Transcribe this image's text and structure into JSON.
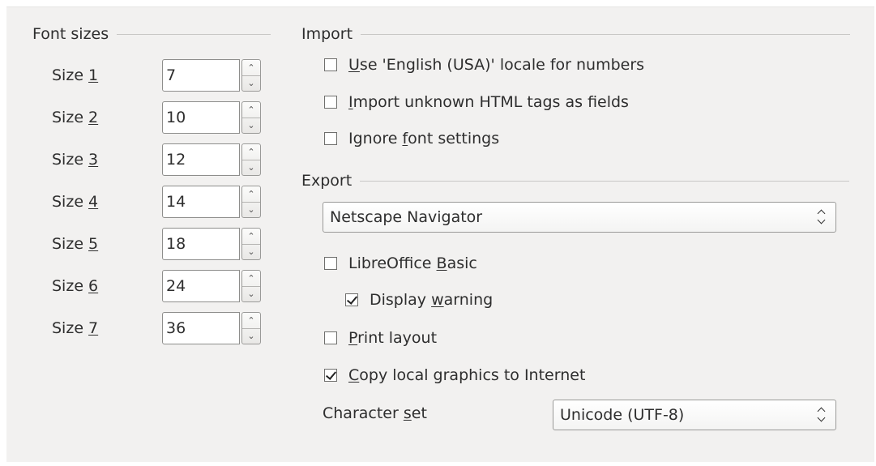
{
  "font_sizes": {
    "title": "Font sizes",
    "rows": [
      {
        "label": "Size ",
        "key": "1",
        "value": "7"
      },
      {
        "label": "Size ",
        "key": "2",
        "value": "10"
      },
      {
        "label": "Size ",
        "key": "3",
        "value": "12"
      },
      {
        "label": "Size ",
        "key": "4",
        "value": "14"
      },
      {
        "label": "Size ",
        "key": "5",
        "value": "18"
      },
      {
        "label": "Size ",
        "key": "6",
        "value": "24"
      },
      {
        "label": "Size ",
        "key": "7",
        "value": "36"
      }
    ]
  },
  "import": {
    "title": "Import",
    "use_locale": {
      "pre": "",
      "key": "U",
      "post": "se 'English (USA)' locale for numbers",
      "checked": false
    },
    "unknown_tags": {
      "pre": "",
      "key": "I",
      "post": "mport unknown HTML tags as fields",
      "checked": false
    },
    "ignore_font": {
      "pre": "Ignore ",
      "key": "f",
      "post": "ont settings",
      "checked": false
    }
  },
  "export": {
    "title": "Export",
    "browser_select": "Netscape Navigator",
    "basic": {
      "pre": "LibreOffice ",
      "key": "B",
      "post": "asic",
      "checked": false
    },
    "display_warning": {
      "pre": "Display ",
      "key": "w",
      "post": "arning",
      "checked": true
    },
    "print_layout": {
      "pre": "",
      "key": "P",
      "post": "rint layout",
      "checked": false
    },
    "copy_graphics": {
      "pre": "",
      "key": "C",
      "post": "opy local graphics to Internet",
      "checked": true
    },
    "charset": {
      "pre": "Character ",
      "key": "s",
      "post": "et",
      "value": "Unicode (UTF-8)"
    }
  }
}
